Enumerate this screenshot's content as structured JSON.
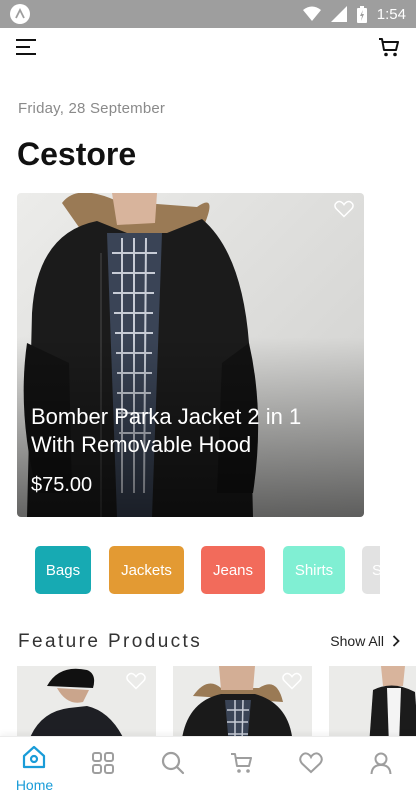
{
  "status_bar": {
    "time": "1:54"
  },
  "header": {
    "date": "Friday, 28 September",
    "title": "Cestore"
  },
  "hero": {
    "title": "Bomber Parka Jacket 2 in 1 With Removable Hood",
    "price": "$75.00"
  },
  "categories": [
    {
      "label": "Bags",
      "color": "#17aab3"
    },
    {
      "label": "Jackets",
      "color": "#e39a33"
    },
    {
      "label": "Jeans",
      "color": "#f26b5b"
    },
    {
      "label": "Shirts",
      "color": "#80efd3"
    },
    {
      "label": "S",
      "color": "#e2e2e2"
    }
  ],
  "feature": {
    "title": "Feature Products",
    "show_all": "Show All"
  },
  "bottom_nav": {
    "active": "Home",
    "items": [
      {
        "label": "Home",
        "icon": "home-icon"
      },
      {
        "icon": "grid-icon"
      },
      {
        "icon": "search-icon"
      },
      {
        "icon": "cart-icon"
      },
      {
        "icon": "heart-icon"
      },
      {
        "icon": "profile-icon"
      }
    ]
  },
  "colors": {
    "accent": "#1a9cd8",
    "status_bar": "#9e9e9e"
  }
}
